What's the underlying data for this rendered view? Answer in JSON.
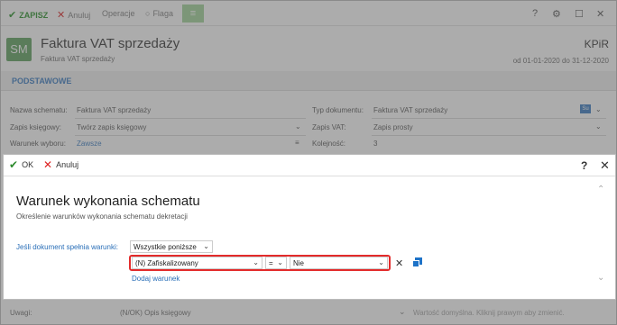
{
  "toolbar": {
    "save_label": "ZAPISZ",
    "cancel_label": "Anuluj",
    "operations_label": "Operacje",
    "flag_label": "Flaga",
    "menu_glyph": "≡",
    "help_glyph": "?",
    "settings_glyph": "⚙",
    "maximize_glyph": "☐",
    "close_glyph": "✕"
  },
  "header": {
    "badge": "SM",
    "title": "Faktura VAT sprzedaży",
    "subtitle": "Faktura VAT sprzedaży",
    "book": "KPiR",
    "date_range": "od 01-01-2020 do 31-12-2020"
  },
  "section": {
    "title": "PODSTAWOWE"
  },
  "form": {
    "schema_name_label": "Nazwa schematu:",
    "schema_name_value": "Faktura VAT sprzedaży",
    "doc_type_label": "Typ dokumentu:",
    "doc_type_value": "Faktura VAT sprzedaży",
    "doc_type_badge": "Su",
    "entry_label": "Zapis księgowy:",
    "entry_value": "Twórz zapis księgowy",
    "vat_label": "Zapis VAT:",
    "vat_value": "Zapis prosty",
    "condition_label": "Warunek wyboru:",
    "condition_value": "Zawsze",
    "order_label": "Kolejność:",
    "order_value": "3"
  },
  "bottom": {
    "notes_label": "Uwagi:",
    "notes_value": "(N/OK) Opis księgowy",
    "hint": "Wartość domyślna. Kliknij prawym aby zmienić."
  },
  "modal": {
    "ok_label": "OK",
    "cancel_label": "Anuluj",
    "help_glyph": "?",
    "close_glyph": "✕",
    "title": "Warunek wykonania schematu",
    "description": "Określenie warunków wykonania schematu dekretacji",
    "condition_label": "Jeśli dokument spełnia warunki:",
    "condition_mode": "Wszystkie poniższe",
    "field": "(N) Zafiskalizowany",
    "operator": "=",
    "value": "Nie",
    "add_condition": "Dodaj warunek"
  },
  "colors": {
    "accent": "#2a6fb8",
    "highlight": "#e32b2b",
    "ok": "#2e8b2e",
    "cancel": "#d22222"
  }
}
